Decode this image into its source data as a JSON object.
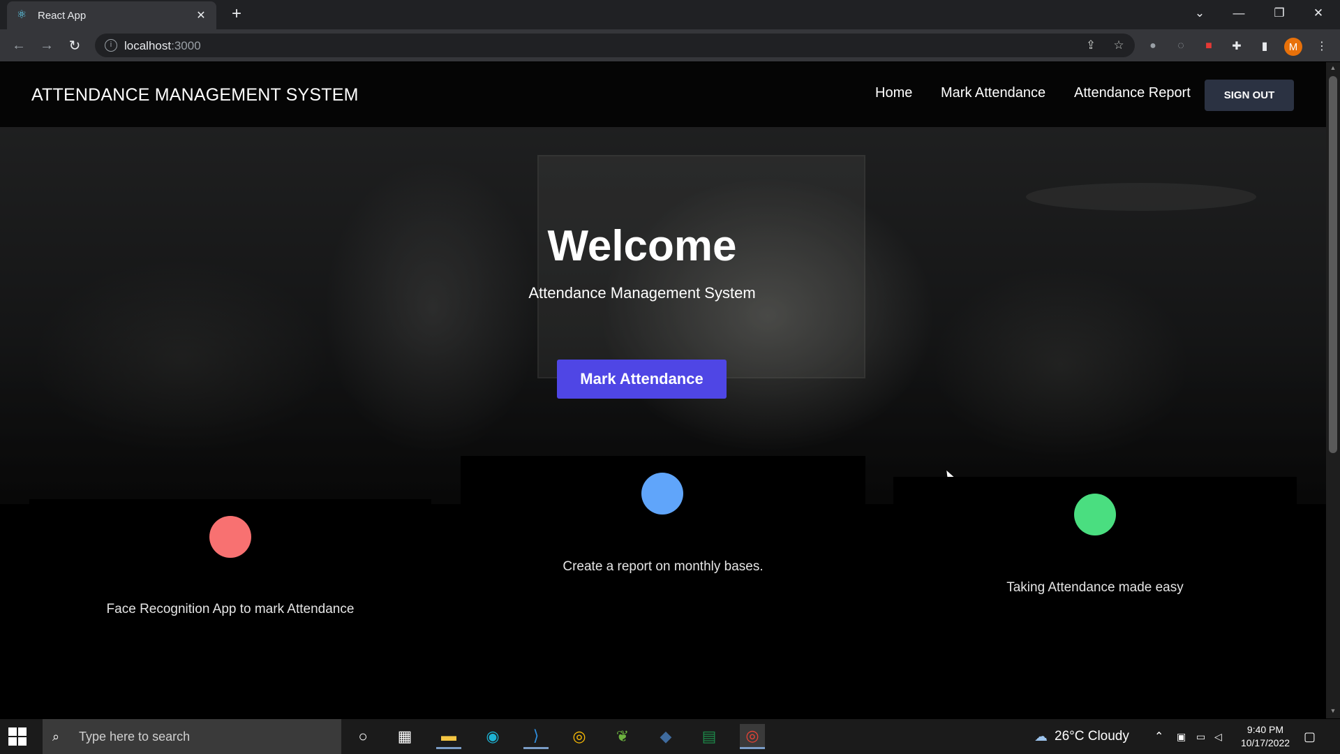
{
  "browser": {
    "tab_title": "React App",
    "url_host": "localhost",
    "url_port": ":3000",
    "accent": "#35363a"
  },
  "site": {
    "brand": "ATTENDANCE MANAGEMENT SYSTEM",
    "nav": [
      "Home",
      "Mark Attendance",
      "Attendance Report"
    ],
    "signout": "SIGN OUT"
  },
  "hero": {
    "title": "Welcome",
    "subtitle": "Attendance Management System",
    "button": "Mark Attendance",
    "button_color": "#4f46e5"
  },
  "features": [
    {
      "text": "Face Recognition App to mark Attendance",
      "color": "#f87171"
    },
    {
      "text": "Create a report on monthly bases.",
      "color": "#60a5fa"
    },
    {
      "text": "Taking Attendance made easy",
      "color": "#4ade80"
    }
  ],
  "taskbar": {
    "search_placeholder": "Type here to search",
    "weather": "26°C  Cloudy",
    "time": "9:40 PM",
    "date": "10/17/2022"
  }
}
